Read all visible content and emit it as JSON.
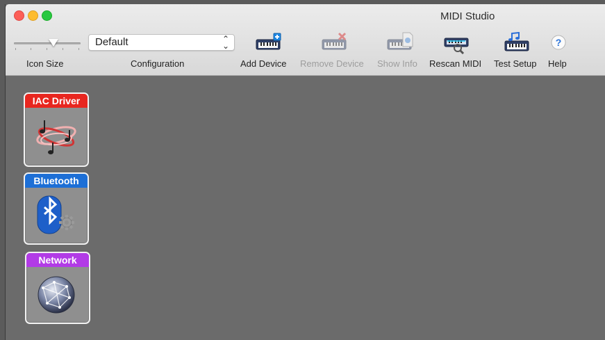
{
  "window": {
    "title": "MIDI Studio"
  },
  "toolbar": {
    "icon_size_label": "Icon Size",
    "configuration_label": "Configuration",
    "configuration_value": "Default",
    "buttons": [
      {
        "label": "Add Device",
        "enabled": true,
        "icon": "add-device-icon"
      },
      {
        "label": "Remove Device",
        "enabled": false,
        "icon": "remove-device-icon"
      },
      {
        "label": "Show Info",
        "enabled": false,
        "icon": "show-info-icon"
      },
      {
        "label": "Rescan MIDI",
        "enabled": true,
        "icon": "rescan-midi-icon"
      },
      {
        "label": "Test Setup",
        "enabled": true,
        "icon": "test-setup-icon"
      },
      {
        "label": "Help",
        "enabled": true,
        "icon": "help-icon"
      }
    ]
  },
  "devices": [
    {
      "label": "IAC Driver",
      "color": "#e8261f",
      "icon": "iac-driver-icon"
    },
    {
      "label": "Bluetooth",
      "color": "#1d6fd6",
      "icon": "bluetooth-icon"
    },
    {
      "label": "Network",
      "color": "#b23be6",
      "icon": "network-globe-icon"
    }
  ]
}
